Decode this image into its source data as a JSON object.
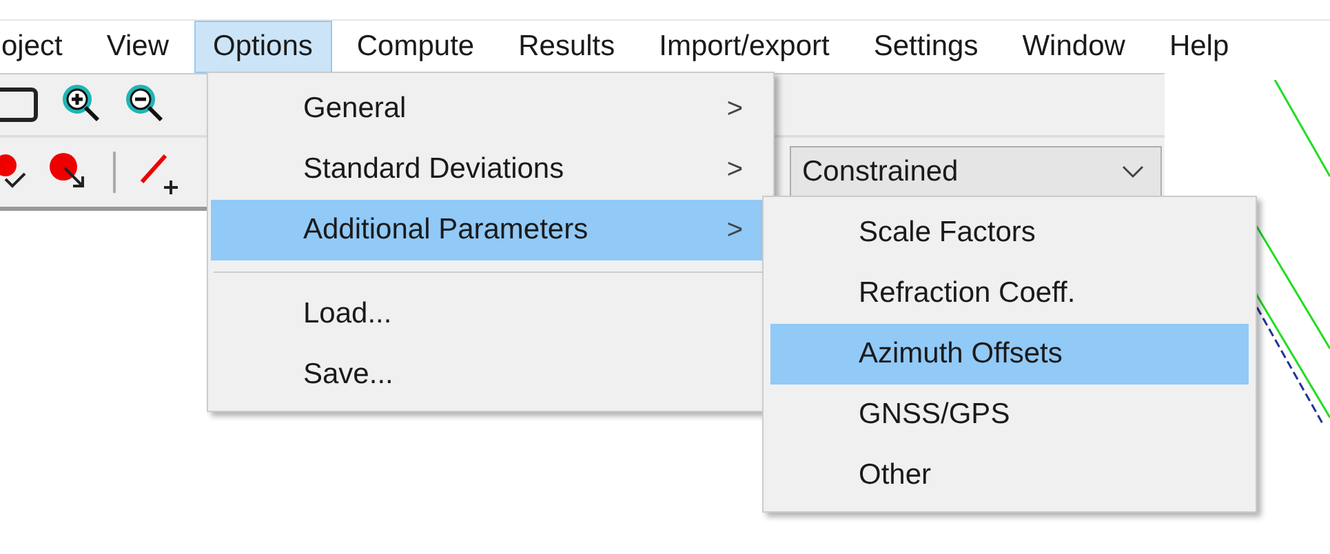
{
  "menubar": [
    {
      "label": "oject",
      "selected": false
    },
    {
      "label": "View",
      "selected": false
    },
    {
      "label": "Options",
      "selected": true
    },
    {
      "label": "Compute",
      "selected": false
    },
    {
      "label": "Results",
      "selected": false
    },
    {
      "label": "Import/export",
      "selected": false
    },
    {
      "label": "Settings",
      "selected": false
    },
    {
      "label": "Window",
      "selected": false
    },
    {
      "label": "Help",
      "selected": false
    }
  ],
  "toolbar": {
    "combo": {
      "value": "Constrained"
    }
  },
  "options_menu": [
    {
      "kind": "item",
      "label": "General",
      "submenu_arrow": ">",
      "selected": false
    },
    {
      "kind": "item",
      "label": "Standard Deviations",
      "submenu_arrow": ">",
      "selected": false
    },
    {
      "kind": "item",
      "label": "Additional Parameters",
      "submenu_arrow": ">",
      "selected": true
    },
    {
      "kind": "separator"
    },
    {
      "kind": "item",
      "label": "Load...",
      "selected": false
    },
    {
      "kind": "item",
      "label": "Save...",
      "selected": false
    }
  ],
  "submenu": [
    {
      "label": "Scale Factors",
      "selected": false
    },
    {
      "label": "Refraction Coeff.",
      "selected": false
    },
    {
      "label": "Azimuth Offsets",
      "selected": true
    },
    {
      "label": "GNSS/GPS",
      "selected": false
    },
    {
      "label": "Other",
      "selected": false
    }
  ]
}
